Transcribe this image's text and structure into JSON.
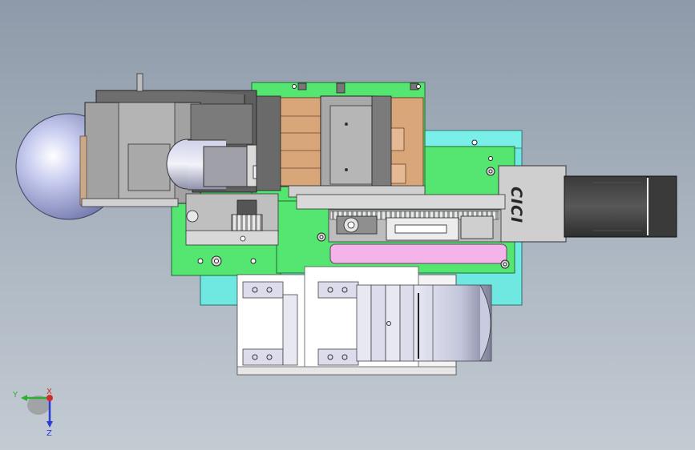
{
  "viewport": {
    "background_top": "#8e9aa9",
    "background_bottom": "#c3cbd3"
  },
  "colors": {
    "green_plate": "#55e672",
    "cyan_plate": "#6fe8e2",
    "copper": "#d9a67a",
    "pink_bar": "#f4b4ea",
    "dark_gray": "#4f4f4f",
    "mid_gray": "#9a9a9a",
    "light_gray": "#cfcfcf",
    "sphere": "#b9bee8"
  },
  "motor": {
    "label": "CICI"
  },
  "triad": {
    "y_label": "Y",
    "x_label": "X",
    "z_label": "Z",
    "y_color": "#2fae2f",
    "x_color": "#d42a2a",
    "z_color": "#2a3ad4"
  }
}
